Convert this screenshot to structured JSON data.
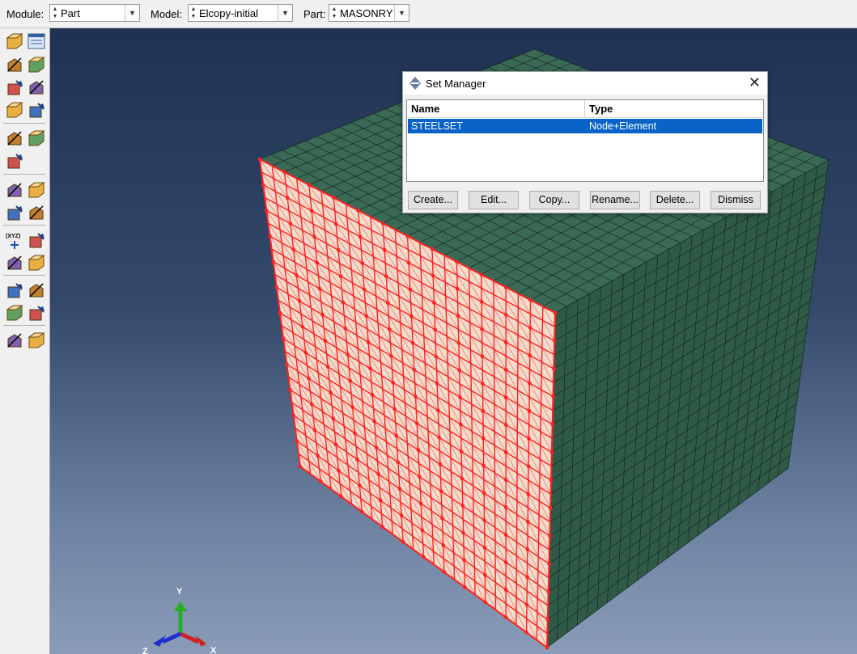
{
  "context": {
    "module_label": "Module:",
    "module_value": "Part",
    "model_label": "Model:",
    "model_value": "Elcopy-initial",
    "part_label": "Part:",
    "part_value": "MASONRY"
  },
  "dialog": {
    "title": "Set Manager",
    "columns": [
      "Name",
      "Type"
    ],
    "rows": [
      {
        "name": "STEELSET",
        "type": "Node+Element",
        "selected": true
      }
    ],
    "buttons": {
      "create": "Create...",
      "edit": "Edit...",
      "copy": "Copy...",
      "rename": "Rename...",
      "delete": "Delete...",
      "dismiss": "Dismiss"
    }
  },
  "triad": {
    "x": "X",
    "y": "Y",
    "z": "Z"
  },
  "toolbox": {
    "xyz_label": "(XYZ)",
    "tools": [
      "create-part-icon",
      "part-manager-icon",
      "create-solid-extrude-icon",
      "create-cut-extrude-icon",
      "create-shell-icon",
      "create-round-fillet-icon",
      "create-wire-icon",
      "partition-cell-icon",
      "create-datum-point-icon",
      "create-datum-axis-icon",
      "edit-feature-icon",
      "query-pick-icon",
      "create-reference-point-icon",
      "sweep-icon",
      "cut-scissors-icon",
      "datum-csys-icon",
      "datum-axis-tripod-icon",
      "datum-plane-icon",
      "datum-manager-icon",
      "attribute-icon",
      "wave-pattern-icon",
      "edit-part-icon",
      "tools-wrench-icon",
      "set-create-icon",
      "surface-create-icon"
    ]
  },
  "colors": {
    "mesh_face": "#3a6a55",
    "mesh_line": "#102018",
    "highlight": "#ff2020",
    "highlight_face": "#f2dccb",
    "selection": "#0a64c8"
  }
}
